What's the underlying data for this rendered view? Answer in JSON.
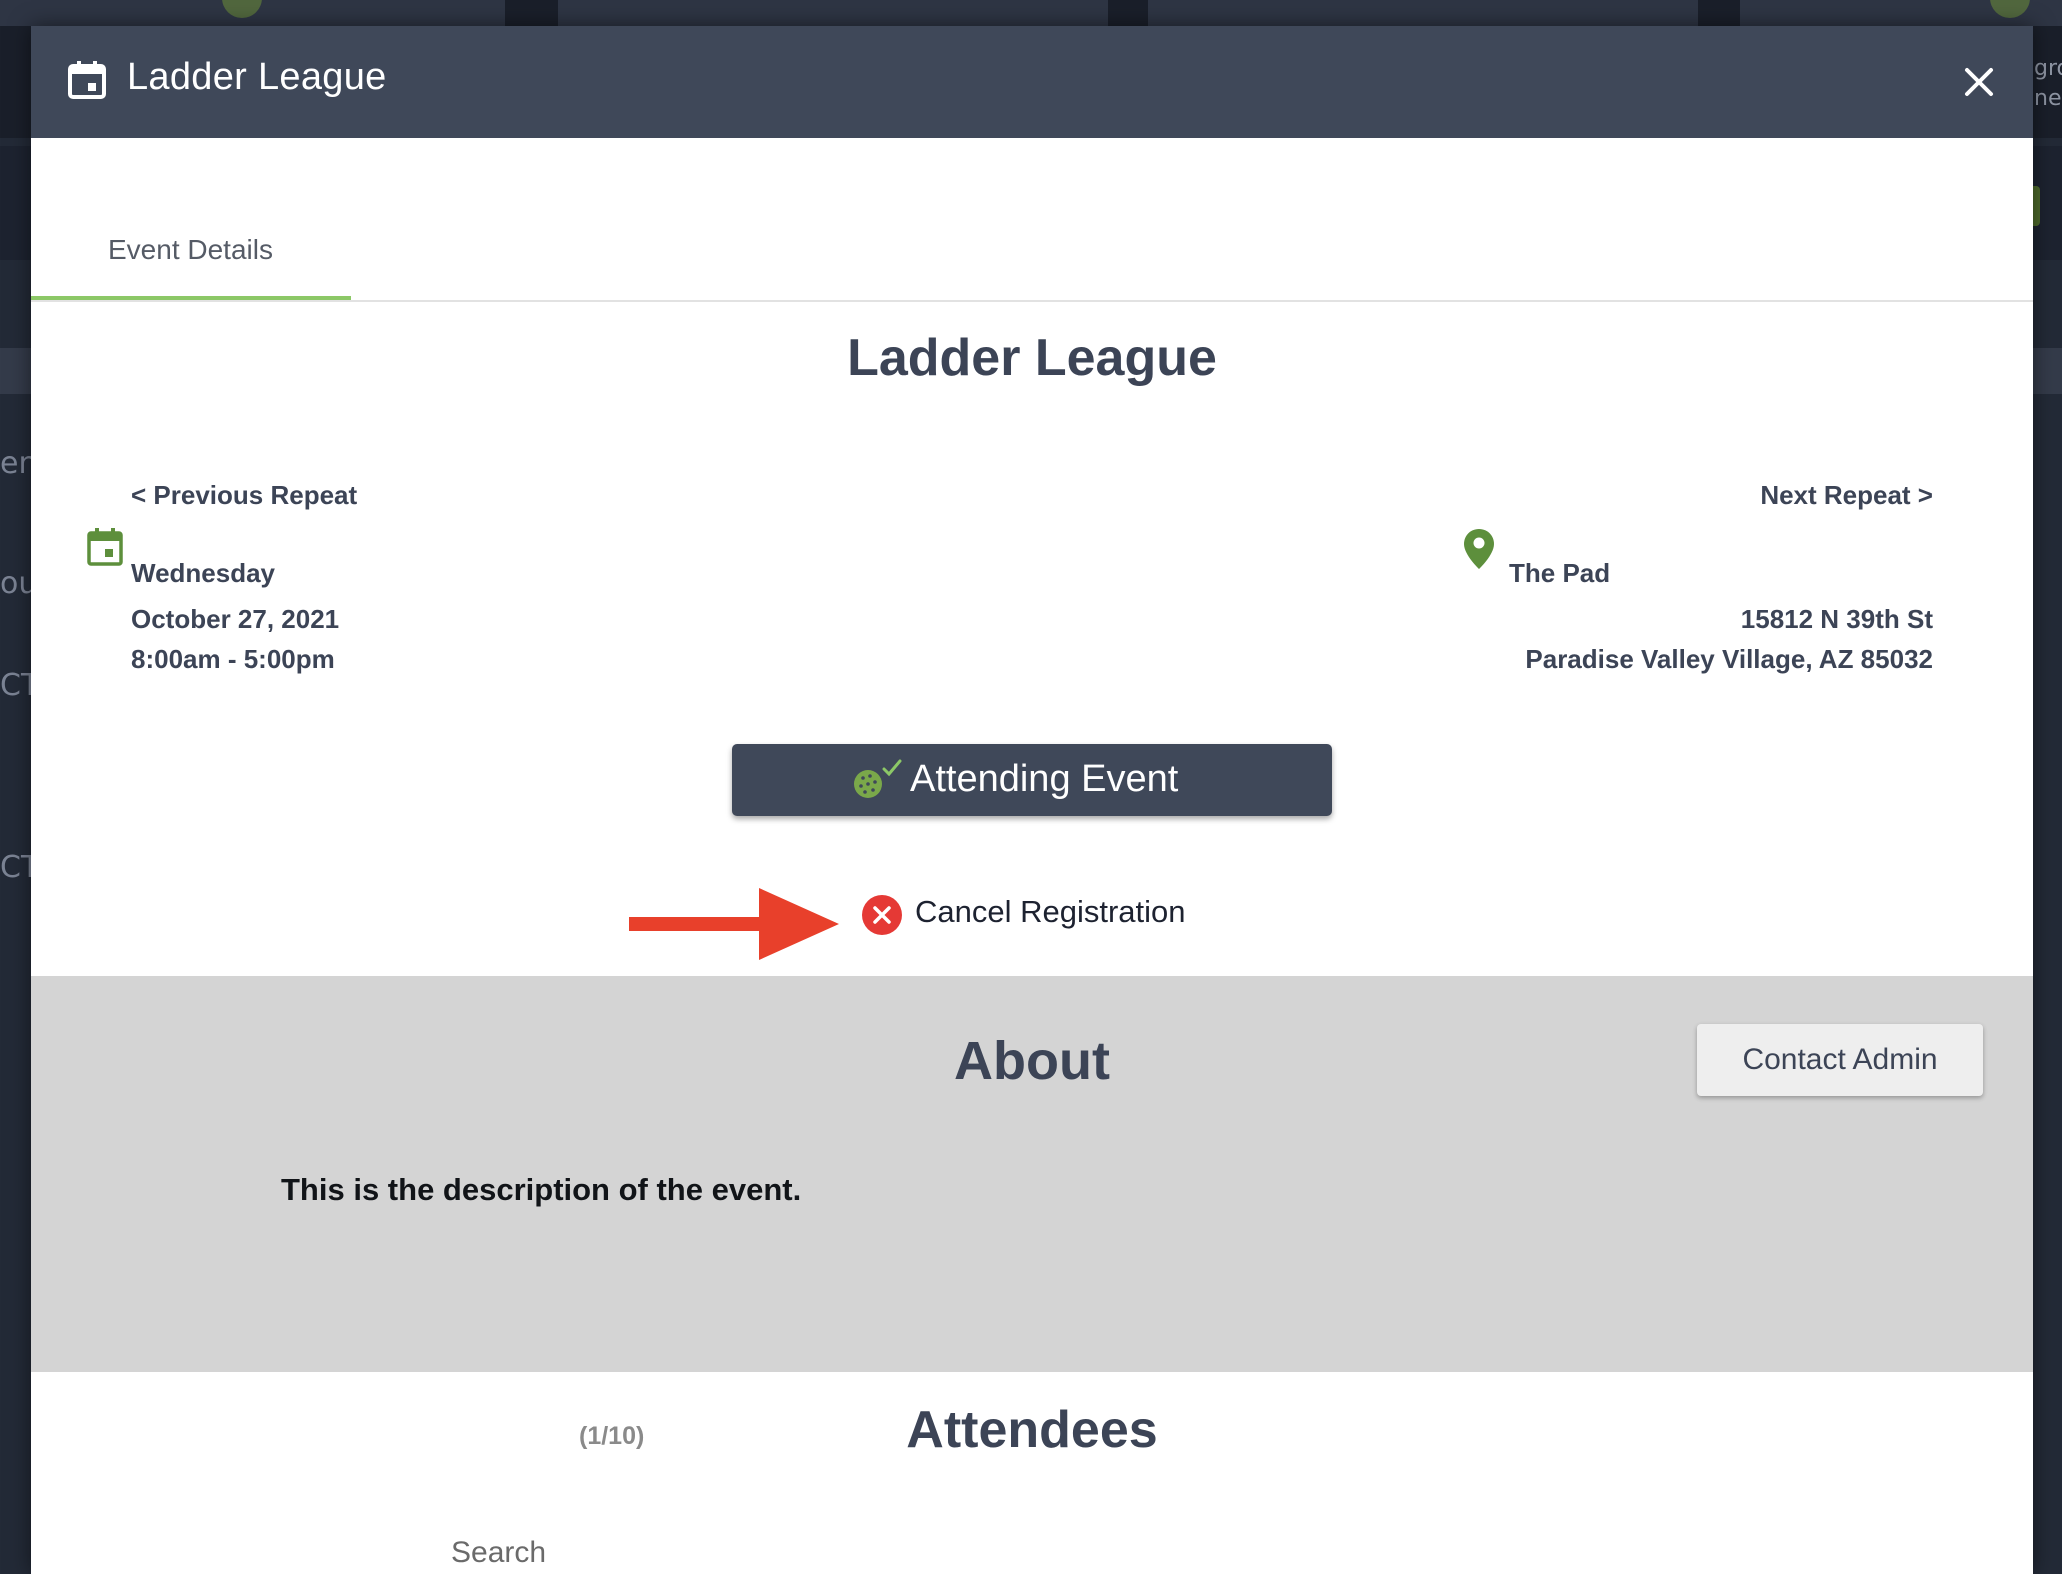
{
  "background": {
    "side_fragments": [
      "ent",
      "ou",
      "CT",
      "CT"
    ],
    "right_fragments": [
      "gro",
      "ner"
    ]
  },
  "modal": {
    "title": "Ladder League",
    "header_icon": "calendar-icon",
    "close_icon": "close-icon"
  },
  "tabs": [
    {
      "label": "Event Details",
      "active": true
    }
  ],
  "event": {
    "title": "Ladder League",
    "prev_repeat": "< Previous Repeat",
    "next_repeat": "Next Repeat >",
    "day": "Wednesday",
    "date": "October 27, 2021",
    "time": "8:00am - 5:00pm",
    "location_name": "The Pad",
    "address_line1": "15812 N 39th St",
    "address_line2": "Paradise Valley Village, AZ 85032",
    "attend_button": "Attending Event",
    "cancel_label": "Cancel Registration"
  },
  "about": {
    "title": "About",
    "contact_button": "Contact Admin",
    "description": "This is the description of the event."
  },
  "attendees": {
    "count": "(1/10)",
    "title": "Attendees",
    "search_placeholder": "Search"
  },
  "colors": {
    "header": "#3f4859",
    "accent_green": "#8cc867",
    "icon_green": "#5d8f3c",
    "arrow_red": "#e8402b",
    "cancel_red": "#e53935",
    "about_bg": "#d4d4d4"
  }
}
